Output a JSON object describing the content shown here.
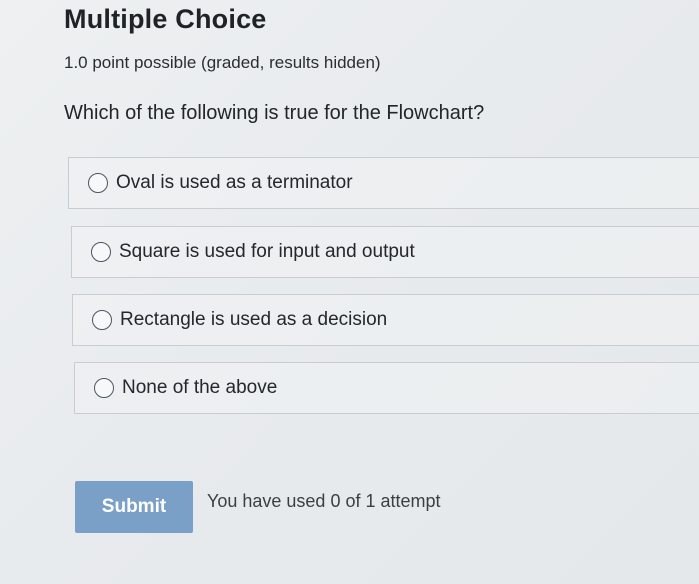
{
  "problem": {
    "title": "Multiple Choice",
    "points": "1.0 point possible (graded, results hidden)",
    "question": "Which of the following is true for the Flowchart?",
    "choices": [
      {
        "label": "Oval is used as a terminator",
        "selected": false
      },
      {
        "label": "Square is used for input and output",
        "selected": false
      },
      {
        "label": "Rectangle is used as a decision",
        "selected": false
      },
      {
        "label": "None of the above",
        "selected": false
      }
    ],
    "submit_label": "Submit",
    "attempts_text": "You have used 0 of 1 attempt"
  },
  "colors": {
    "submit_button": "#7ba0c7",
    "background": "#eceef0",
    "choice_border": "#c9cdd1"
  }
}
